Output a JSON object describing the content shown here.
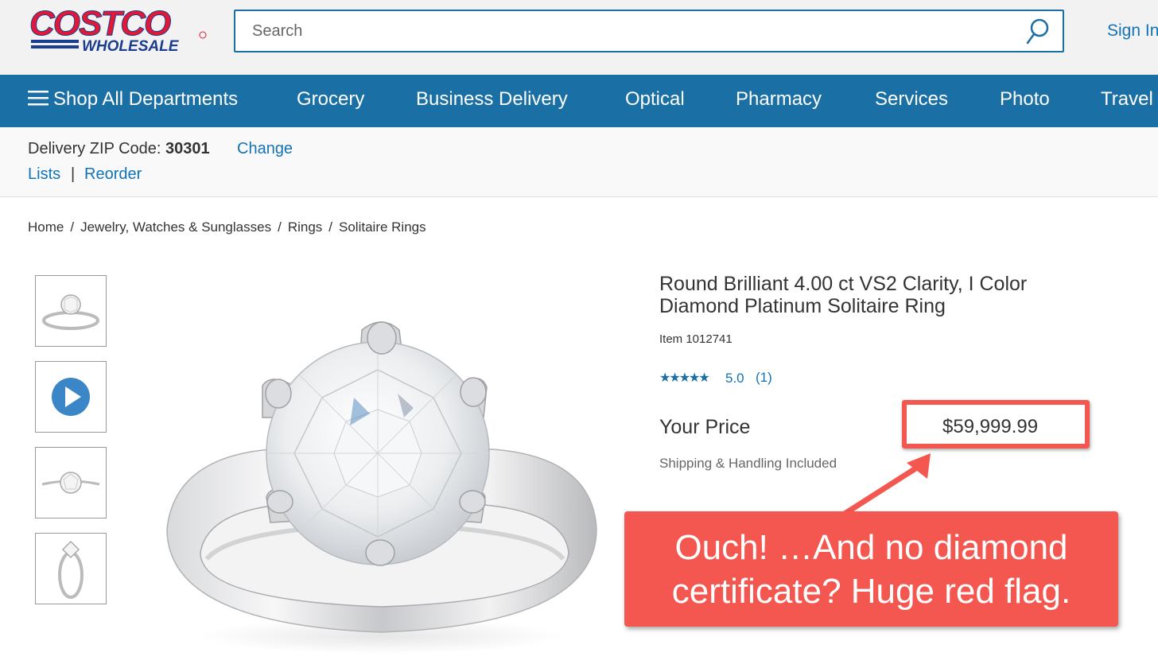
{
  "header": {
    "logo_top": "COSTCO",
    "logo_bottom": "WHOLESALE",
    "search_placeholder": "Search",
    "sign_in": "Sign In"
  },
  "nav": {
    "items": [
      "Shop All Departments",
      "Grocery",
      "Business Delivery",
      "Optical",
      "Pharmacy",
      "Services",
      "Photo",
      "Travel"
    ]
  },
  "subbar": {
    "zip_label": "Delivery ZIP Code:",
    "zip_value": "30301",
    "change": "Change",
    "lists": "Lists",
    "separator": "|",
    "reorder": "Reorder"
  },
  "breadcrumb": [
    "Home",
    "Jewelry, Watches & Sunglasses",
    "Rings",
    "Solitaire Rings"
  ],
  "product": {
    "title": "Round Brilliant 4.00 ct VS2 Clarity, I Color Diamond Platinum Solitaire Ring",
    "item_number": "Item  1012741",
    "stars": "★★★★★",
    "rating": "5.0",
    "review_count": "(1)",
    "price_label": "Your Price",
    "price": "$59,999.99",
    "shipping": "Shipping & Handling Included"
  },
  "thumbnails": [
    "ring-front-thumbnail",
    "video-play-thumbnail",
    "ring-top-thumbnail",
    "ring-side-thumbnail"
  ],
  "annotation": {
    "callout_line1": "Ouch! …And no diamond",
    "callout_line2": "certificate? Huge red flag."
  },
  "colors": {
    "brand_blue": "#1a6fa5",
    "brand_red": "#e31837",
    "link_blue": "#1273b6",
    "annotation_red": "#f4574f"
  }
}
